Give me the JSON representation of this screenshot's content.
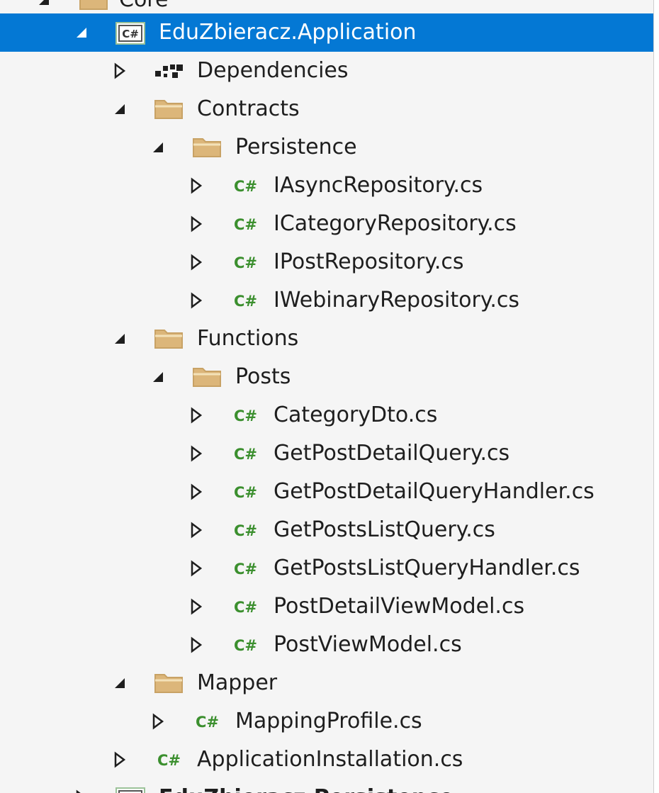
{
  "panel": "Solution Explorer",
  "tree": {
    "partial_top_label": "Core",
    "project": "EduZbieracz.Application",
    "items": [
      {
        "label": "Dependencies",
        "icon": "dependencies-icon",
        "state": "collapsed"
      },
      {
        "label": "Contracts",
        "icon": "folder-icon",
        "state": "expanded"
      },
      {
        "label": "Persistence",
        "icon": "folder-icon",
        "state": "expanded"
      },
      {
        "label": "IAsyncRepository.cs",
        "icon": "csharp-file-icon",
        "state": "collapsed"
      },
      {
        "label": "ICategoryRepository.cs",
        "icon": "csharp-file-icon",
        "state": "collapsed"
      },
      {
        "label": "IPostRepository.cs",
        "icon": "csharp-file-icon",
        "state": "collapsed"
      },
      {
        "label": "IWebinaryRepository.cs",
        "icon": "csharp-file-icon",
        "state": "collapsed"
      },
      {
        "label": "Functions",
        "icon": "folder-icon",
        "state": "expanded"
      },
      {
        "label": "Posts",
        "icon": "folder-icon",
        "state": "expanded"
      },
      {
        "label": "CategoryDto.cs",
        "icon": "csharp-file-icon",
        "state": "collapsed"
      },
      {
        "label": "GetPostDetailQuery.cs",
        "icon": "csharp-file-icon",
        "state": "collapsed"
      },
      {
        "label": "GetPostDetailQueryHandler.cs",
        "icon": "csharp-file-icon",
        "state": "collapsed"
      },
      {
        "label": "GetPostsListQuery.cs",
        "icon": "csharp-file-icon",
        "state": "collapsed"
      },
      {
        "label": "GetPostsListQueryHandler.cs",
        "icon": "csharp-file-icon",
        "state": "collapsed"
      },
      {
        "label": "PostDetailViewModel.cs",
        "icon": "csharp-file-icon",
        "state": "collapsed"
      },
      {
        "label": "PostViewModel.cs",
        "icon": "csharp-file-icon",
        "state": "collapsed"
      },
      {
        "label": "Mapper",
        "icon": "folder-icon",
        "state": "expanded"
      },
      {
        "label": "MappingProfile.cs",
        "icon": "csharp-file-icon",
        "state": "collapsed"
      },
      {
        "label": "ApplicationInstallation.cs",
        "icon": "csharp-file-icon",
        "state": "collapsed"
      }
    ],
    "partial_bottom_label": "EduZbieracz.Persistence"
  },
  "colors": {
    "selection": "#0478d4",
    "background": "#f5f5f5",
    "folder": "#dcb67a",
    "csharp": "#3b8f2e",
    "text": "#1e1e1e"
  }
}
